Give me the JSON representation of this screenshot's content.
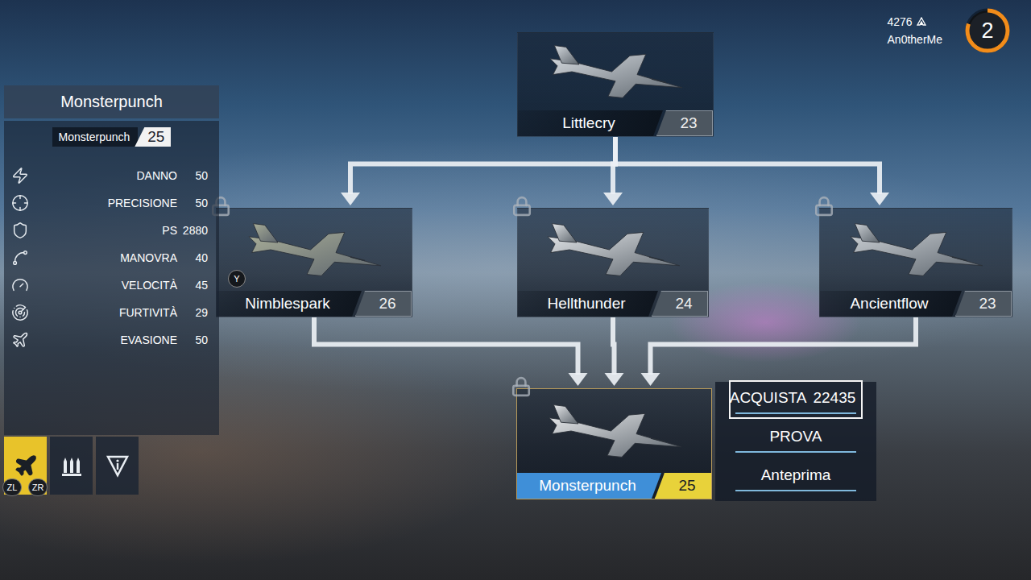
{
  "hud": {
    "currency": "4276",
    "player": "An0therMe",
    "rank": "2",
    "rank_progress": 0.8
  },
  "panel": {
    "title": "Monsterpunch",
    "aircraft": "Monsterpunch",
    "level": "25",
    "stats": [
      {
        "label": "DANNO",
        "value": "50"
      },
      {
        "label": "PRECISIONE",
        "value": "50"
      },
      {
        "label": "PS",
        "value": "2880"
      },
      {
        "label": "MANOVRA",
        "value": "40"
      },
      {
        "label": "VELOCITÀ",
        "value": "45"
      },
      {
        "label": "FURTIVITÀ",
        "value": "29"
      },
      {
        "label": "EVASIONE",
        "value": "50"
      }
    ]
  },
  "tabs": [
    {
      "kind": "aircraft",
      "selected": true,
      "buttons": [
        "ZL",
        "ZR"
      ]
    },
    {
      "kind": "weapons",
      "selected": false,
      "buttons": []
    },
    {
      "kind": "info",
      "selected": false,
      "buttons": []
    }
  ],
  "tree": {
    "nodes": [
      {
        "name": "Littlecry",
        "level": "23",
        "locked": false,
        "selected": false
      },
      {
        "name": "Nimblespark",
        "level": "26",
        "locked": true,
        "selected": false,
        "button": "Y"
      },
      {
        "name": "Hellthunder",
        "level": "24",
        "locked": true,
        "selected": false
      },
      {
        "name": "Ancientflow",
        "level": "23",
        "locked": true,
        "selected": false
      },
      {
        "name": "Monsterpunch",
        "level": "25",
        "locked": true,
        "selected": true
      }
    ],
    "edges": [
      {
        "from": "Littlecry",
        "to": "Nimblespark"
      },
      {
        "from": "Littlecry",
        "to": "Hellthunder"
      },
      {
        "from": "Littlecry",
        "to": "Ancientflow"
      },
      {
        "from": "Nimblespark",
        "to": "Monsterpunch"
      },
      {
        "from": "Hellthunder",
        "to": "Monsterpunch"
      },
      {
        "from": "Ancientflow",
        "to": "Monsterpunch"
      }
    ]
  },
  "menu": [
    {
      "label": "ACQUISTA",
      "price": "22435",
      "selected": true
    },
    {
      "label": "PROVA",
      "selected": false
    },
    {
      "label": "Anteprima",
      "selected": false
    }
  ]
}
